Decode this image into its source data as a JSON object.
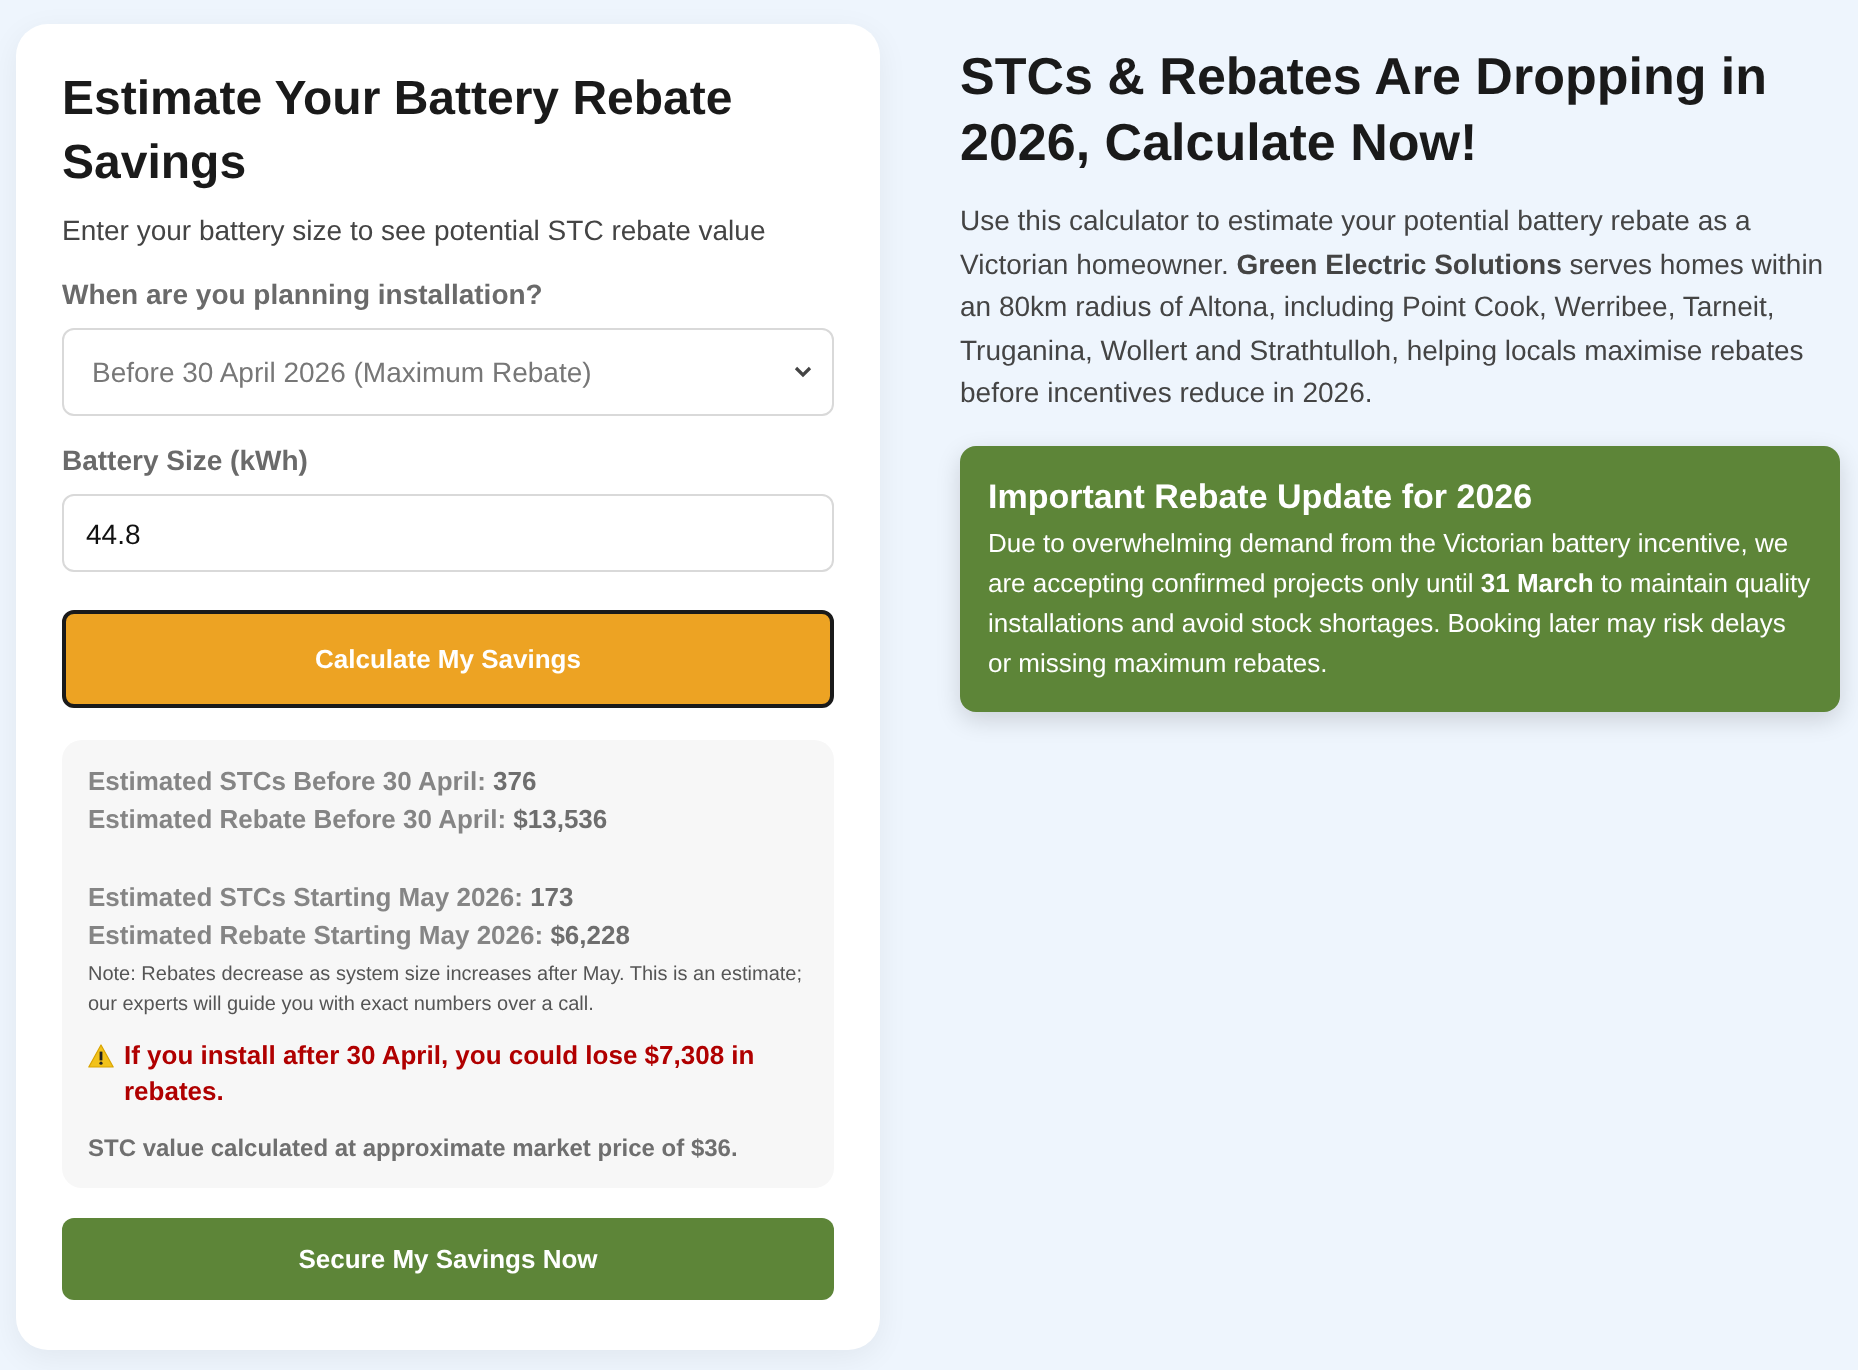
{
  "calculator": {
    "title": "Estimate Your Battery Rebate Savings",
    "subtitle": "Enter your battery size to see potential STC rebate value",
    "fields": [
      {
        "kind": "select",
        "label": "When are you planning installation?",
        "value": "Before 30 April 2026 (Maximum Rebate)"
      },
      {
        "kind": "input",
        "label": "Battery Size (kWh)",
        "value": "44.8"
      }
    ],
    "calculate_button": "Calculate My Savings",
    "results": {
      "groups": [
        {
          "lines": [
            "Estimated STCs Before 30 April: **376**",
            "Estimated Rebate Before 30 April: **$13,536**"
          ]
        },
        {
          "lines": [
            "Estimated STCs Starting May 2026: **173**",
            "Estimated Rebate Starting May 2026: **$6,228**"
          ]
        }
      ],
      "note": "Note: Rebates decrease as system size increases after May. This is an estimate; our experts will guide you with exact numbers over a call.",
      "warning": "If you install after 30 April, you could lose **$7,308** in rebates.",
      "market_note": "STC value calculated at approximate market price of $36."
    },
    "secure_button": "Secure My Savings Now"
  },
  "info": {
    "title": "STCs & Rebates Are Dropping in 2026, Calculate Now!",
    "paragraph": "Use this calculator to estimate your potential battery rebate as a Victorian homeowner. **Green Electric Solutions** serves homes within an 80km radius of Altona, including Point Cook, Werribee, Tarneit, Truganina, Wollert and Strathtulloh, helping locals maximise rebates before incentives reduce in 2026.",
    "update": {
      "title": "Important Rebate Update for 2026",
      "body": "Due to overwhelming demand from the Victorian battery incentive, we are accepting confirmed projects only until **31 March** to maintain quality installations and avoid stock shortages. Booking later may risk delays or missing maximum rebates."
    }
  }
}
